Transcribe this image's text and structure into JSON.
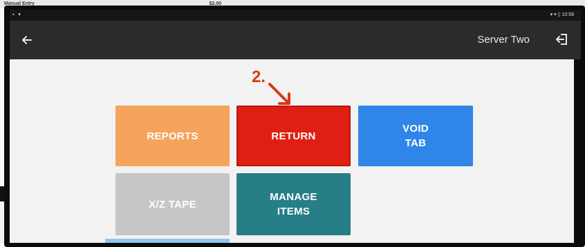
{
  "background": {
    "row_label": "Manual Entry",
    "row_amount": "$2.00"
  },
  "status_bar": {
    "left_icons": "▪ ▾",
    "right_text": "▾ ▾ ▯ 10:58"
  },
  "header": {
    "back_icon": "arrow-left-icon",
    "user_name": "Server Two",
    "logout_icon": "logout-icon"
  },
  "annotation": {
    "step": "2."
  },
  "tiles": {
    "reports": "REPORTS",
    "return": "RETURN",
    "void_tab_line1": "VOID",
    "void_tab_line2": "TAB",
    "xz_tape": "X/Z TAPE",
    "manage_items_line1": "MANAGE",
    "manage_items_line2": "ITEMS"
  },
  "colors": {
    "reports": "#f6a45c",
    "return": "#df1f13",
    "void_tab": "#2f86e8",
    "xz_tape": "#c6c6c6",
    "manage_items": "#277e86",
    "annotation": "#d83a17"
  }
}
